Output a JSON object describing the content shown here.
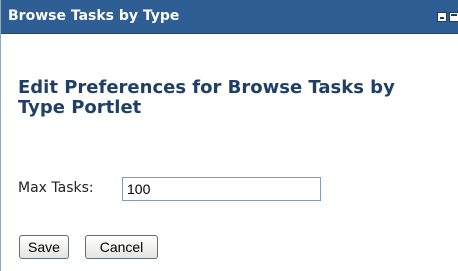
{
  "portlet": {
    "title": "Browse Tasks by Type",
    "controls": {
      "minimize_icon": "minimize-icon",
      "maximize_icon": "maximize-icon"
    }
  },
  "main": {
    "heading": "Edit Preferences for Browse Tasks by Type Portlet",
    "form": {
      "max_tasks_label": "Max Tasks:",
      "max_tasks_value": "100"
    },
    "buttons": {
      "save_label": "Save",
      "cancel_label": "Cancel"
    }
  },
  "colors": {
    "titlebar": "#2e5e93",
    "heading": "#1f3f66"
  }
}
